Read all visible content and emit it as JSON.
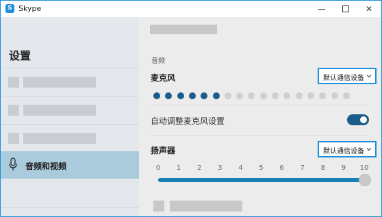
{
  "window": {
    "app_title": "Skype",
    "app_icon_letter": "S",
    "accent_color": "#1e8fd8"
  },
  "sidebar": {
    "title": "设置",
    "active_item_label": "音频和视频"
  },
  "audio": {
    "section_label": "音频",
    "microphone": {
      "label": "麦克风",
      "device": "默认通信设备",
      "level_total_dots": 17,
      "level_active_dots": 6,
      "active_dot_color": "#1a5c8a",
      "inactive_dot_color": "#d0d0d0"
    },
    "auto_adjust": {
      "label": "自动调整麦克风设置",
      "enabled": true
    },
    "speaker": {
      "label": "扬声器",
      "device": "默认通信设备",
      "scale_labels": [
        "0",
        "1",
        "2",
        "3",
        "4",
        "5",
        "6",
        "7",
        "8",
        "9",
        "10"
      ],
      "volume_value": 10,
      "volume_max": 10
    }
  }
}
